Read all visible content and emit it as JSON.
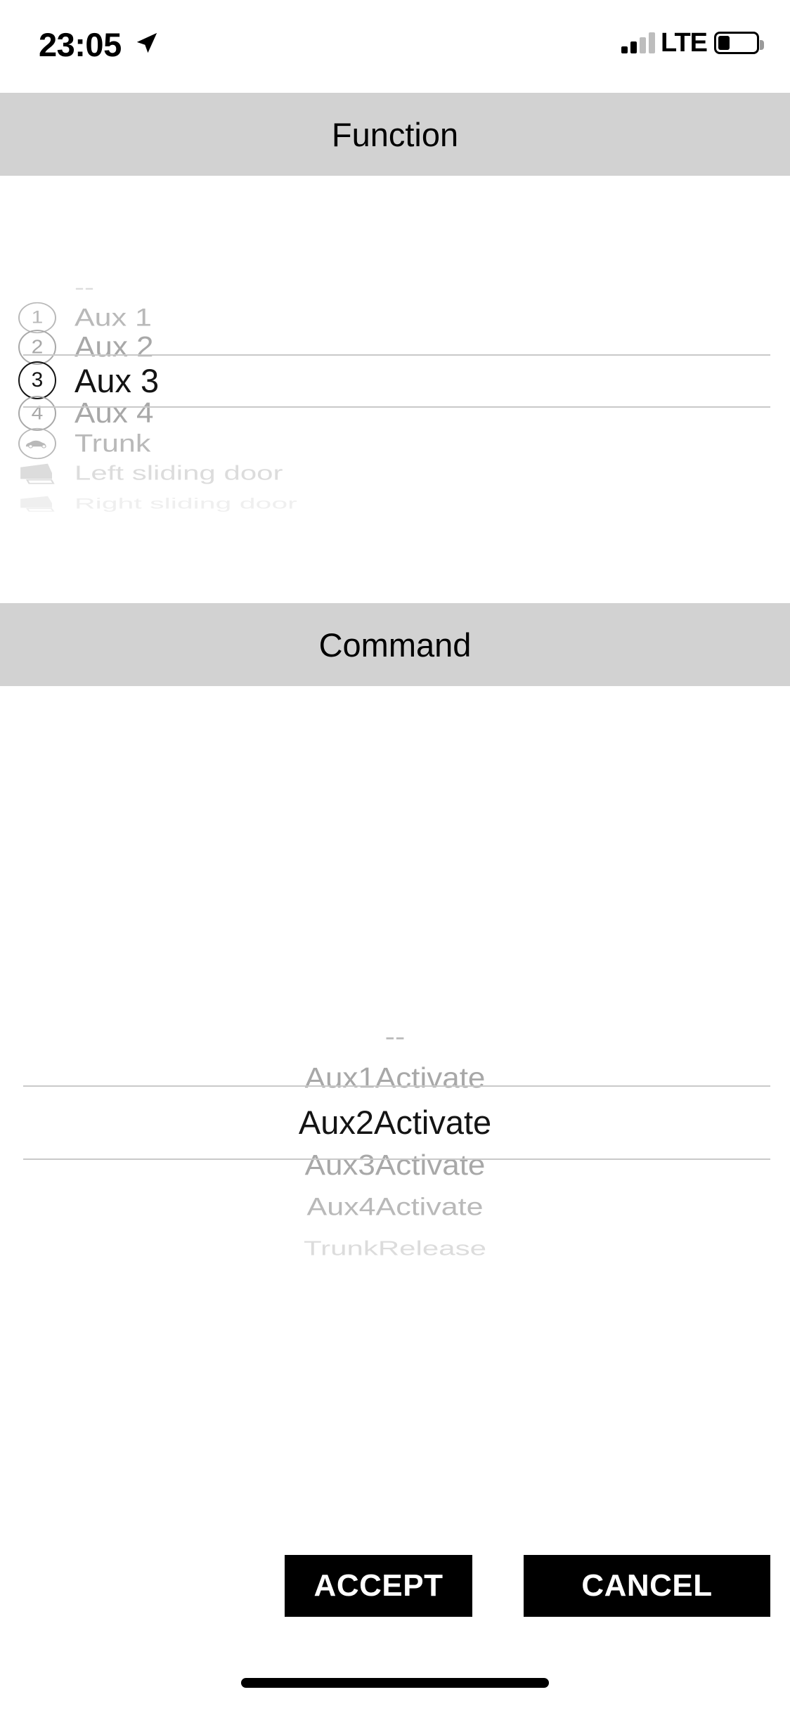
{
  "status_bar": {
    "time": "23:05",
    "location_icon": "location-arrow-icon",
    "signal_icon": "cellular-signal-icon",
    "network": "LTE",
    "battery_icon": "battery-low-icon"
  },
  "function_section": {
    "header": "Function",
    "selected_index": 3,
    "items": [
      {
        "label": "--",
        "icon": "none",
        "icon_text": "",
        "state": "far-dim"
      },
      {
        "label": "Aux 1",
        "icon": "number-circle",
        "icon_text": "1",
        "state": "dim"
      },
      {
        "label": "Aux 2",
        "icon": "number-circle",
        "icon_text": "2",
        "state": "near"
      },
      {
        "label": "Aux 3",
        "icon": "number-circle",
        "icon_text": "3",
        "state": "selected"
      },
      {
        "label": "Aux 4",
        "icon": "number-circle",
        "icon_text": "4",
        "state": "near"
      },
      {
        "label": "Trunk",
        "icon": "car-circle",
        "icon_text": "",
        "state": "dim"
      },
      {
        "label": "Left sliding door",
        "icon": "door",
        "icon_text": "",
        "state": "far-dim"
      },
      {
        "label": "Right sliding door",
        "icon": "door",
        "icon_text": "",
        "state": "faint"
      }
    ]
  },
  "command_section": {
    "header": "Command",
    "selected_index": 2,
    "items": [
      {
        "label": "--",
        "state": "dim"
      },
      {
        "label": "Aux1Activate",
        "state": "near"
      },
      {
        "label": "Aux2Activate",
        "state": "selected"
      },
      {
        "label": "Aux3Activate",
        "state": "near"
      },
      {
        "label": "Aux4Activate",
        "state": "dim"
      },
      {
        "label": "TrunkRelease",
        "state": "far-dim"
      }
    ]
  },
  "actions": {
    "accept_label": "ACCEPT",
    "cancel_label": "CANCEL"
  },
  "colors": {
    "header_bg": "#d2d2d2",
    "selected_text": "#111111",
    "button_bg": "#000000",
    "separator": "#c9c9c9"
  }
}
